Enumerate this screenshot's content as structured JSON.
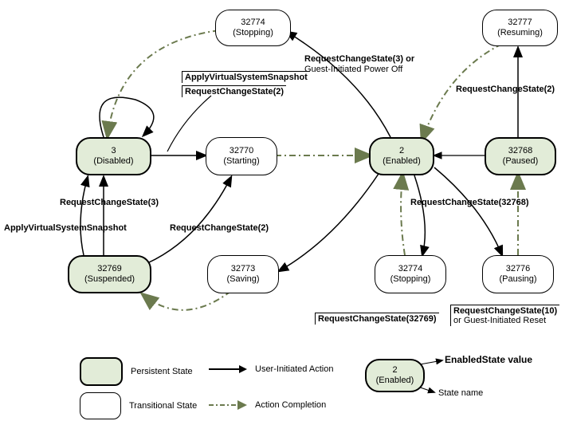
{
  "nodes": {
    "stopping_top": {
      "value": "32774",
      "name": "(Stopping)"
    },
    "resuming": {
      "value": "32777",
      "name": "(Resuming)"
    },
    "disabled": {
      "value": "3",
      "name": "(Disabled)"
    },
    "starting": {
      "value": "32770",
      "name": "(Starting)"
    },
    "enabled": {
      "value": "2",
      "name": "(Enabled)"
    },
    "paused": {
      "value": "32768",
      "name": "(Paused)"
    },
    "suspended": {
      "value": "32769",
      "name": "(Suspended)"
    },
    "saving": {
      "value": "32773",
      "name": "(Saving)"
    },
    "stopping_low": {
      "value": "32774",
      "name": "(Stopping)"
    },
    "pausing": {
      "value": "32776",
      "name": "(Pausing)"
    },
    "legend_sample": {
      "value": "2",
      "name": "(Enabled)"
    }
  },
  "edges": {
    "applyVSS_top": "ApplyVirtualSystemSnapshot",
    "rcs2_top": "RequestChangeState(2)",
    "rcs3_or_poweroff_a": "RequestChangeState(3) or",
    "rcs3_or_poweroff_b": "Guest-Initiated Power Off",
    "rcs2_right": "RequestChangeState(2)",
    "rcs3_left": "RequestChangeState(3)",
    "applyVSS_left": "ApplyVirtualSystemSnapshot",
    "rcs2_mid": "RequestChangeState(2)",
    "rcs32768": "RequestChangeState(32768)",
    "rcs32769": "RequestChangeState(32769)",
    "rcs10_a": "RequestChangeState(10)",
    "rcs10_b": "or Guest-Initiated Reset"
  },
  "legend": {
    "persistent": "Persistent State",
    "transitional": "Transitional State",
    "user_action": "User-Initiated Action",
    "completion": "Action Completion",
    "enabled_value": "EnabledState value",
    "state_name": "State name"
  }
}
